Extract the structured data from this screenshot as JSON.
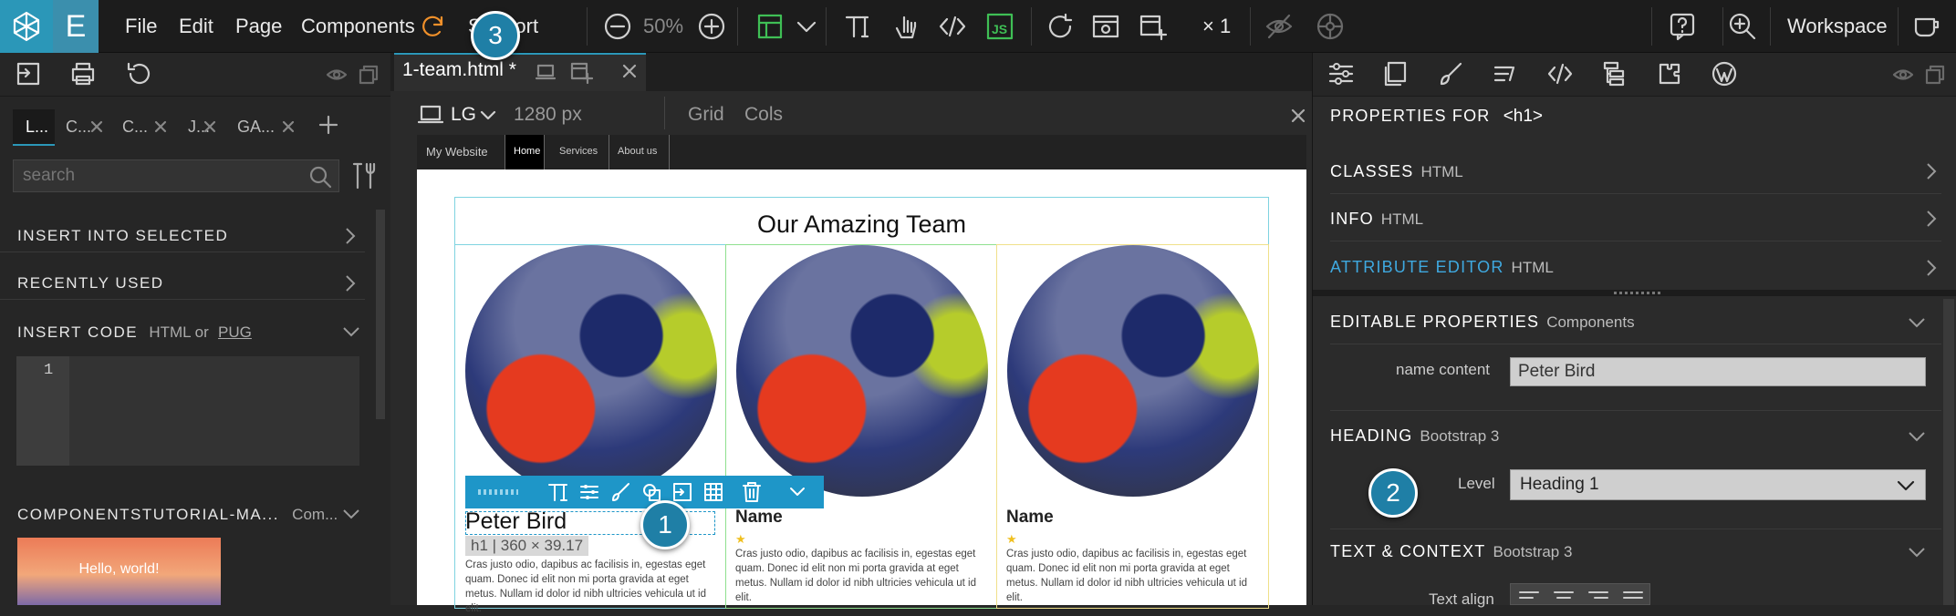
{
  "app": {
    "logo_letter": "E"
  },
  "menu": {
    "file": "File",
    "edit": "Edit",
    "page": "Page",
    "components": "Components",
    "support": "Support"
  },
  "toolbar": {
    "zoom": "50%",
    "multiplier": "× 1",
    "workspace": "Workspace"
  },
  "left": {
    "tabs": [
      "L...",
      "C...",
      "C...",
      "J...",
      "GA..."
    ],
    "search_placeholder": "search",
    "insert_into_selected": "INSERT INTO SELECTED",
    "recently_used": "RECENTLY USED",
    "insert_code": "INSERT CODE",
    "insert_code_sub": "HTML or",
    "insert_code_link": "PUG",
    "line_number": "1",
    "components_lib": "COMPONENTSTUTORIAL-MA...",
    "components_lib_sub": "Com...",
    "thumb_text": "Hello, world!"
  },
  "center": {
    "file_tab": "1-team.html *",
    "device": "LG",
    "width": "1280 px",
    "grid": "Grid",
    "cols": "Cols"
  },
  "site": {
    "nav": [
      "My Website",
      "Home",
      "Services",
      "About us"
    ],
    "heading": "Our Amazing Team",
    "cards": [
      {
        "name": "Peter Bird",
        "text": "Cras justo odio, dapibus ac facilisis in, egestas eget quam. Donec id elit non mi porta gravida at eget metus. Nullam id dolor id nibh ultricies vehicula ut id elit."
      },
      {
        "name": "Name",
        "text": "Cras justo odio, dapibus ac facilisis in, egestas eget quam. Donec id elit non mi porta gravida at eget metus. Nullam id dolor id nibh ultricies vehicula ut id elit."
      },
      {
        "name": "Name",
        "text": "Cras justo odio, dapibus ac facilisis in, egestas eget quam. Donec id elit non mi porta gravida at eget metus. Nullam id dolor id nibh ultricies vehicula ut id elit."
      }
    ],
    "selection_info": "h1 | 360 × 39.17"
  },
  "right": {
    "properties_for": "PROPERTIES FOR",
    "element": "<h1>",
    "sections": [
      {
        "title": "CLASSES",
        "sub": "HTML"
      },
      {
        "title": "INFO",
        "sub": "HTML"
      },
      {
        "title": "ATTRIBUTE EDITOR",
        "sub": "HTML"
      }
    ],
    "editable": {
      "title": "EDITABLE PROPERTIES",
      "sub": "Components",
      "field_label": "name content",
      "field_value": "Peter Bird"
    },
    "heading": {
      "title": "HEADING",
      "sub": "Bootstrap 3",
      "level_label": "Level",
      "level_value": "Heading 1"
    },
    "text_context": {
      "title": "TEXT & CONTEXT",
      "sub": "Bootstrap 3",
      "align_label": "Text align"
    }
  },
  "badges": [
    "1",
    "2",
    "3"
  ],
  "colors": {
    "accent": "#2b97b8",
    "js_green": "#3fbf55",
    "toolbar_blue": "#1e96c8"
  }
}
